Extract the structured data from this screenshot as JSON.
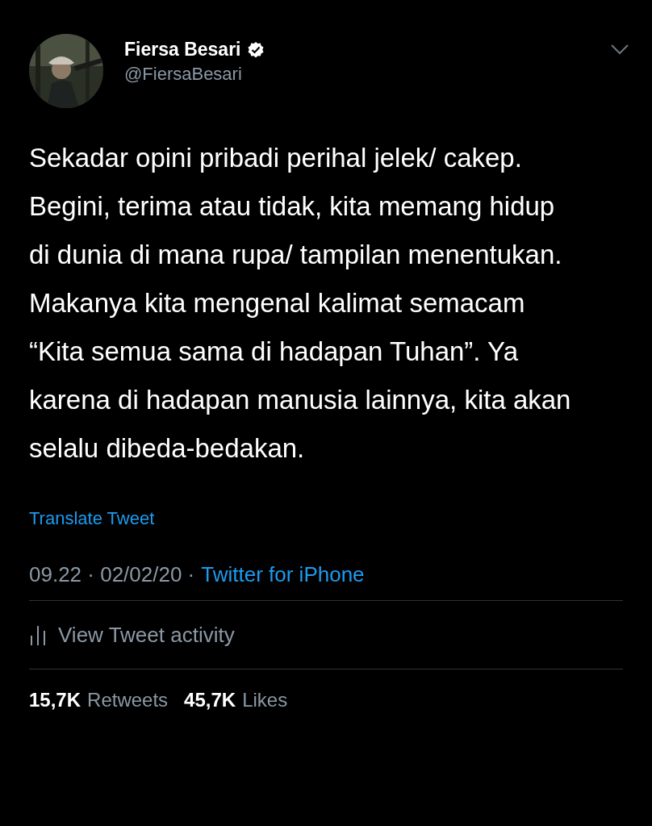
{
  "author": {
    "name": "Fiersa Besari",
    "handle": "@FiersaBesari",
    "verified": true
  },
  "text": "Sekadar opini pribadi perihal jelek/ cakep. Begini, terima atau tidak, kita memang hidup di dunia di mana rupa/ tampilan menentukan. Makanya kita mengenal kalimat semacam “Kita semua sama di hadapan Tuhan”. Ya karena di hadapan manusia lainnya, kita akan selalu dibeda-bedakan.",
  "translate": "Translate Tweet",
  "meta": {
    "time": "09.22 · 02/02/20 ·",
    "source": "Twitter for iPhone"
  },
  "activity": "View Tweet activity",
  "stats": [
    {
      "count": "15,7K",
      "label": "Retweets"
    },
    {
      "count": "45,7K",
      "label": "Likes"
    }
  ]
}
